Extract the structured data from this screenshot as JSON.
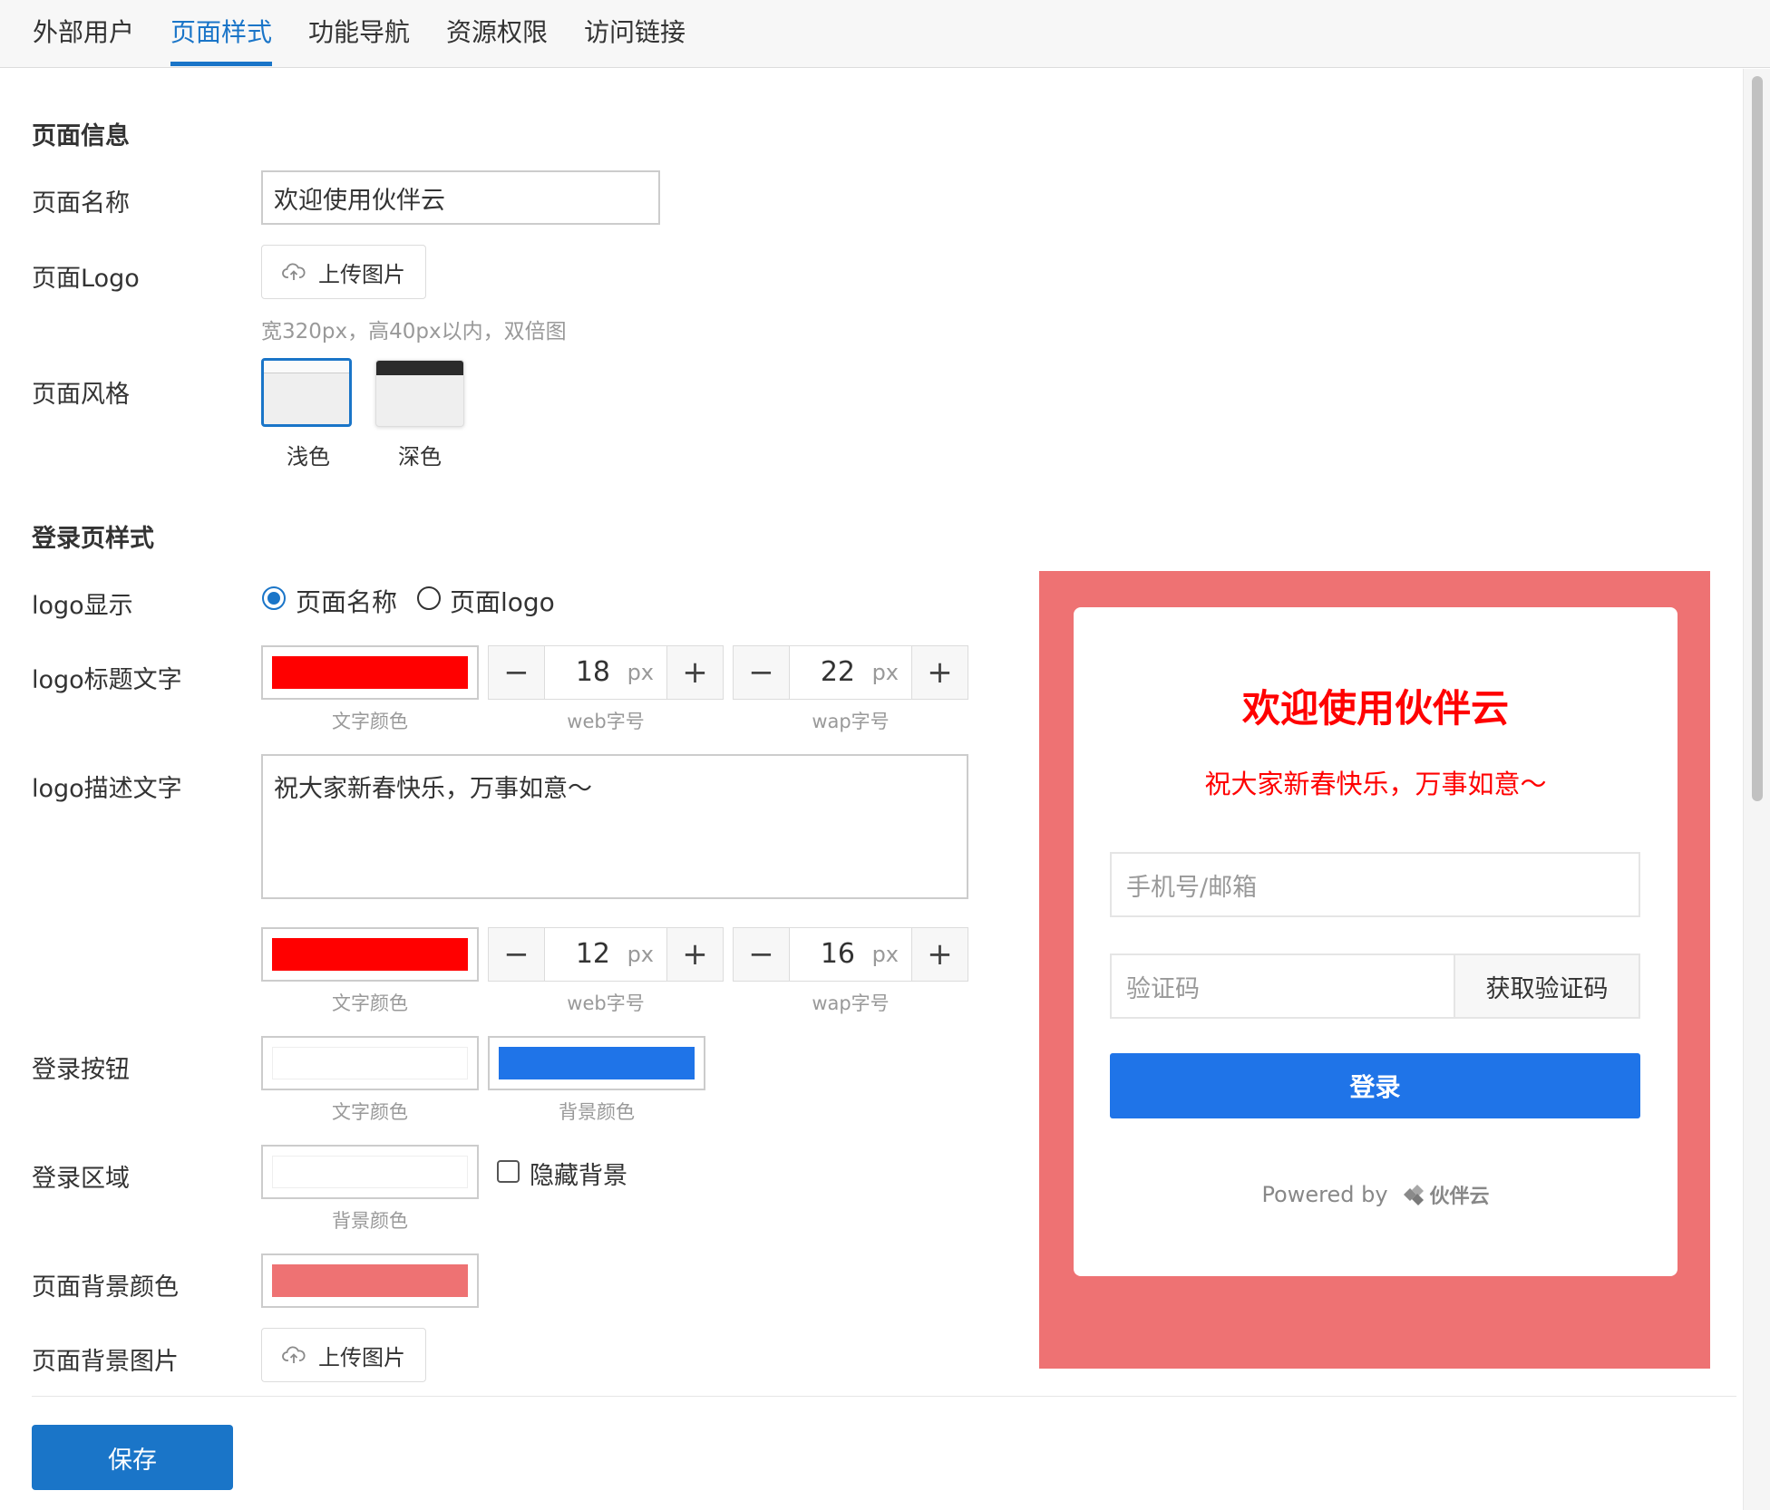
{
  "tabs": [
    "外部用户",
    "页面样式",
    "功能导航",
    "资源权限",
    "访问链接"
  ],
  "active_tab": "页面样式",
  "page_info": {
    "section_title": "页面信息",
    "name_label": "页面名称",
    "name_value": "欢迎使用伙伴云",
    "logo_label": "页面Logo",
    "upload_label": "上传图片",
    "logo_hint": "宽320px，高40px以内，双倍图",
    "style_label": "页面风格",
    "style_light": "浅色",
    "style_dark": "深色",
    "selected_style": "浅色"
  },
  "login_style": {
    "section_title": "登录页样式",
    "logo_display_label": "logo显示",
    "option_name": "页面名称",
    "option_logo": "页面logo",
    "selected_option": "页面名称",
    "title_text_label": "logo标题文字",
    "title_color": "#ff0000",
    "title_web_size": "18",
    "title_wap_size": "22",
    "unit": "px",
    "caption_text_color": "文字颜色",
    "caption_web": "web字号",
    "caption_wap": "wap字号",
    "desc_label": "logo描述文字",
    "desc_value": "祝大家新春快乐，万事如意～",
    "desc_color": "#ff0000",
    "desc_web_size": "12",
    "desc_wap_size": "16",
    "login_btn_label": "登录按钮",
    "btn_text_color": "#ffffff",
    "btn_bg_color": "#1f74e8",
    "caption_bg_color": "背景颜色",
    "login_area_label": "登录区域",
    "area_bg_color": "#ffffff",
    "hide_bg_label": "隐藏背景",
    "hide_bg_checked": false,
    "page_bg_color_label": "页面背景颜色",
    "page_bg_color": "#ee7273",
    "page_bg_image_label": "页面背景图片",
    "upload_label": "上传图片"
  },
  "save_label": "保存",
  "preview": {
    "title": "欢迎使用伙伴云",
    "desc": "祝大家新春快乐，万事如意～",
    "phone_placeholder": "手机号/邮箱",
    "code_placeholder": "验证码",
    "get_code_label": "获取验证码",
    "login_label": "登录",
    "powered_by": "Powered by",
    "brand": "伙伴云"
  }
}
